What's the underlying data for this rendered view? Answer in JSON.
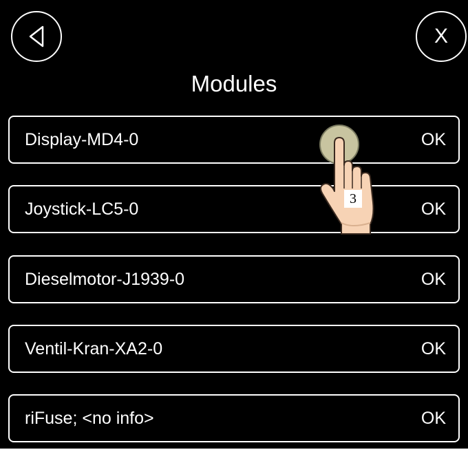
{
  "header": {
    "title": "Modules",
    "close_label": "X"
  },
  "modules": [
    {
      "name": "Display-MD4-0",
      "status": "OK"
    },
    {
      "name": "Joystick-LC5-0",
      "status": "OK"
    },
    {
      "name": "Dieselmotor-J1939-0",
      "status": "OK"
    },
    {
      "name": "Ventil-Kran-XA2-0",
      "status": "OK"
    },
    {
      "name": "riFuse; <no info>",
      "status": "OK"
    }
  ],
  "gesture": {
    "icon": "tap-hand-icon",
    "number": "3"
  },
  "colors": {
    "background": "#000000",
    "foreground": "#ffffff",
    "touch_circle": "#c8c4a0",
    "skin": "#f7d3b5"
  }
}
